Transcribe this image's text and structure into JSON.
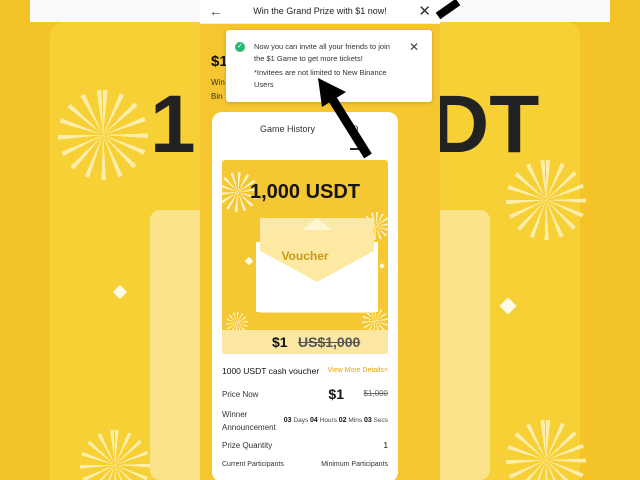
{
  "header": {
    "title": "Win the Grand Prize with $1 now!"
  },
  "peek": {
    "price": "$1",
    "line1": "Win",
    "line2": "Bin"
  },
  "tooltip": {
    "message": "Now you can invite all your friends to join the $1 Game to get more tickets!",
    "note": "*Invitees are not limited to New Binance Users"
  },
  "tabs": [
    {
      "label": "Game History"
    },
    {
      "label": "D"
    }
  ],
  "prize": {
    "amount": "1,000 USDT",
    "voucher_label": "Voucher",
    "price_now": "$1",
    "price_old": "US$1,000"
  },
  "details": {
    "voucher_title": "1000 USDT cash voucher",
    "view_more": "View More Details>",
    "price_now_label": "Price Now",
    "price_now_value": "$1",
    "price_old_value": "$1,000",
    "winner_label_1": "Winner",
    "winner_label_2": "Announcement",
    "countdown": {
      "days": "03",
      "days_label": "Days",
      "hours": "04",
      "hours_label": "Hours",
      "mins": "02",
      "mins_label": "Mins",
      "secs": "03",
      "secs_label": "Secs"
    },
    "qty_label": "Prize Quantity",
    "qty_value": "1",
    "participants_label": "Current Participants",
    "min_participants_label": "Minimum Participants"
  },
  "background": {
    "big_text_left": "1,",
    "big_text_right": "DT"
  },
  "colors": {
    "brand_yellow": "#f5c631",
    "link_gold": "#e0a400",
    "success_green": "#2bb673"
  }
}
